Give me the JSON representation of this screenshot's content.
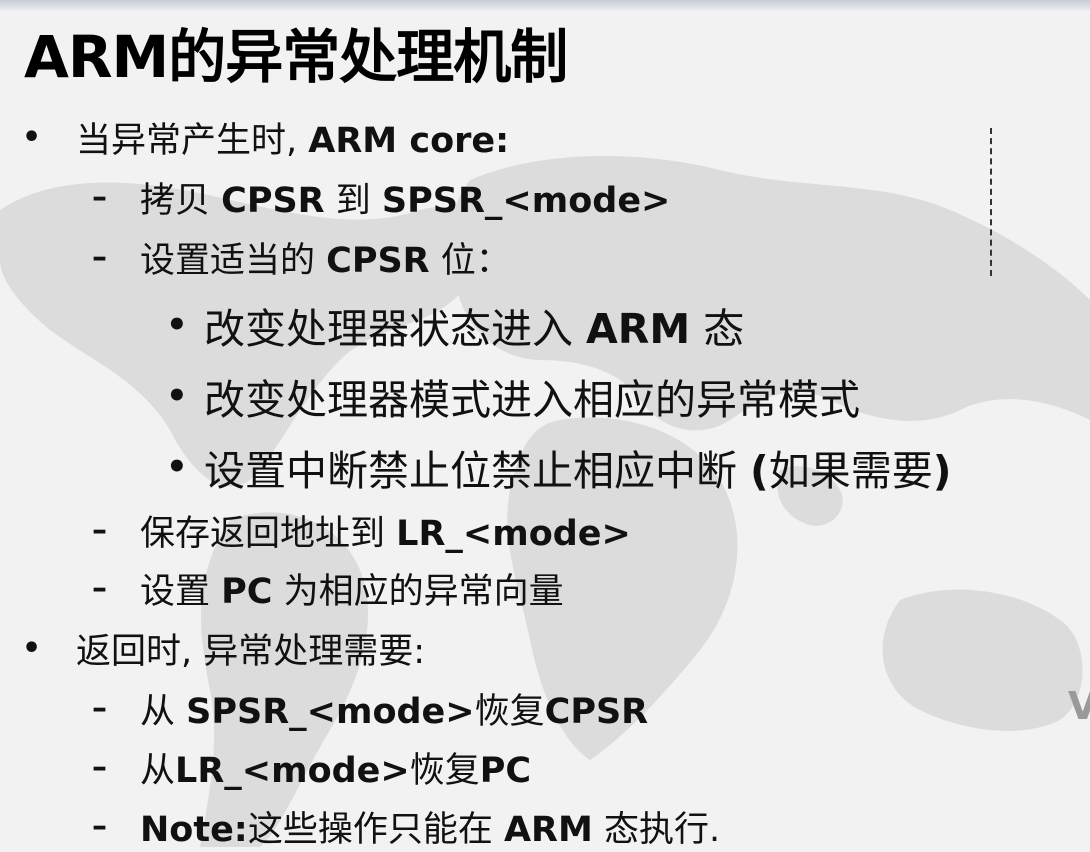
{
  "title": "ARM的异常处理机制",
  "bullet_marker": "•",
  "dash_marker": "–",
  "items": [
    {
      "level": 1,
      "parts": [
        {
          "t": "当异常产生时, "
        },
        {
          "t": "ARM core:",
          "b": true
        }
      ]
    },
    {
      "level": 2,
      "parts": [
        {
          "t": "拷贝 "
        },
        {
          "t": "CPSR",
          "b": true
        },
        {
          "t": " 到 "
        },
        {
          "t": "SPSR_<mode>",
          "b": true
        }
      ]
    },
    {
      "level": 2,
      "parts": [
        {
          "t": "设置适当的 "
        },
        {
          "t": "CPSR",
          "b": true
        },
        {
          "t": " 位："
        }
      ]
    },
    {
      "level": 3,
      "parts": [
        {
          "t": "改变处理器状态进入 "
        },
        {
          "t": "ARM",
          "b": true
        },
        {
          "t": " 态"
        }
      ]
    },
    {
      "level": 3,
      "parts": [
        {
          "t": "改变处理器模式进入相应的异常模式"
        }
      ]
    },
    {
      "level": 3,
      "parts": [
        {
          "t": "设置中断禁止位禁止相应中断 "
        },
        {
          "t": "(",
          "b": true
        },
        {
          "t": "如果需要"
        },
        {
          "t": ")",
          "b": true
        }
      ]
    },
    {
      "level": 2,
      "parts": [
        {
          "t": "保存返回地址到 "
        },
        {
          "t": "LR_<mode>",
          "b": true
        }
      ]
    },
    {
      "level": 2,
      "parts": [
        {
          "t": "设置 "
        },
        {
          "t": "PC",
          "b": true
        },
        {
          "t": " 为相应的异常向量"
        }
      ]
    },
    {
      "level": 1,
      "parts": [
        {
          "t": "返回时, 异常处理需要:"
        }
      ]
    },
    {
      "level": 2,
      "parts": [
        {
          "t": "从 "
        },
        {
          "t": "SPSR_<mode>",
          "b": true
        },
        {
          "t": "恢复"
        },
        {
          "t": "CPSR",
          "b": true
        }
      ]
    },
    {
      "level": 2,
      "parts": [
        {
          "t": "从"
        },
        {
          "t": "LR_<mode>",
          "b": true
        },
        {
          "t": "恢复"
        },
        {
          "t": "PC",
          "b": true
        }
      ]
    },
    {
      "level": 2,
      "parts": [
        {
          "t": "Note:",
          "b": true
        },
        {
          "t": "这些操作只能在 "
        },
        {
          "t": "ARM",
          "b": true
        },
        {
          "t": " 态执行."
        }
      ]
    }
  ],
  "edge_text": "V"
}
